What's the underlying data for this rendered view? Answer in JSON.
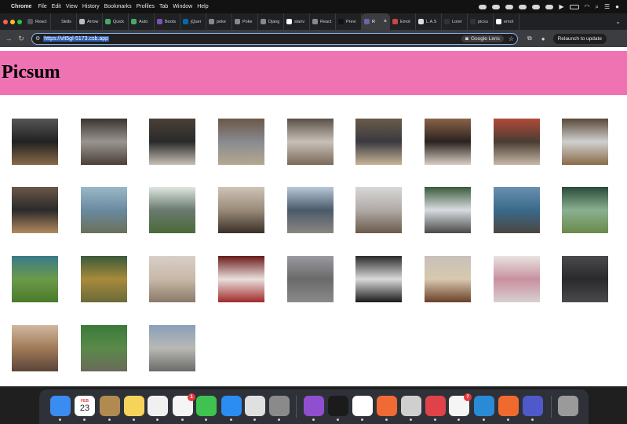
{
  "menubar": {
    "app_name": "Chrome",
    "items": [
      "File",
      "Edit",
      "View",
      "History",
      "Bookmarks",
      "Profiles",
      "Tab",
      "Window",
      "Help"
    ]
  },
  "tabs": [
    {
      "label": "React",
      "color": "#555"
    },
    {
      "label": "Skills",
      "color": "#222"
    },
    {
      "label": "Arrow",
      "color": "#bbb"
    },
    {
      "label": "Quick",
      "color": "#4a6"
    },
    {
      "label": "Auto",
      "color": "#4a6"
    },
    {
      "label": "Boots",
      "color": "#7952b3"
    },
    {
      "label": "jQuer",
      "color": "#0769ad"
    },
    {
      "label": "poke",
      "color": "#888"
    },
    {
      "label": "Poke",
      "color": "#888"
    },
    {
      "label": "Djang",
      "color": "#888"
    },
    {
      "label": "stanv",
      "color": "#fff"
    },
    {
      "label": "React",
      "color": "#888"
    },
    {
      "label": "Previ",
      "color": "#111"
    },
    {
      "label": "R",
      "color": "#66a",
      "active": true
    },
    {
      "label": "Emot",
      "color": "#c44"
    },
    {
      "label": "L.A.S",
      "color": "#ddd"
    },
    {
      "label": "Lorer",
      "color": "#333"
    },
    {
      "label": "picsu",
      "color": "#333"
    },
    {
      "label": "emot",
      "color": "#fff"
    }
  ],
  "toolbar": {
    "url": "https://vlt5gl-5173.csb.app",
    "lens_label": "Google Lens",
    "relaunch_label": "Relaunch to update"
  },
  "page": {
    "title": "Picsum"
  },
  "gallery": [
    {
      "top": "#555",
      "mid": "#222",
      "bot": "#8a6a48"
    },
    {
      "top": "#3a3530",
      "mid": "#9a9490",
      "bot": "#4a4038"
    },
    {
      "top": "#4a4038",
      "mid": "#2a2a2a",
      "bot": "#c8c0b4"
    },
    {
      "top": "#6a5848",
      "mid": "#8a8a90",
      "bot": "#b4a890"
    },
    {
      "top": "#5a5048",
      "mid": "#c8c0b8",
      "bot": "#7a6a58"
    },
    {
      "top": "#6a5a4a",
      "mid": "#3a3a40",
      "bot": "#c8b498"
    },
    {
      "top": "#8a6248",
      "mid": "#2a2220",
      "bot": "#d8cfc2"
    },
    {
      "top": "#b04a38",
      "mid": "#4a3c32",
      "bot": "#c8b8a8"
    },
    {
      "top": "#5a4838",
      "mid": "#d0d0d0",
      "bot": "#8a6a48"
    },
    {
      "top": "#6a5848",
      "mid": "#2a2a2a",
      "bot": "#b48a60"
    },
    {
      "top": "#9ab8c8",
      "mid": "#6a8aa0",
      "bot": "#6a7058"
    },
    {
      "top": "#dfe8e0",
      "mid": "#6a7a70",
      "bot": "#4a6a38"
    },
    {
      "top": "#cfc4b8",
      "mid": "#9a8a78",
      "bot": "#3a3028"
    },
    {
      "top": "#b8c8d8",
      "mid": "#4a5a6a",
      "bot": "#8a8680"
    },
    {
      "top": "#d8d8d8",
      "mid": "#b0aaa6",
      "bot": "#6a5a4a"
    },
    {
      "top": "#3a5a3a",
      "mid": "#d8dce0",
      "bot": "#4a4a48"
    },
    {
      "top": "#6a90b0",
      "mid": "#3a6a8a",
      "bot": "#4a4640"
    },
    {
      "top": "#2a4a3a",
      "mid": "#8ab090",
      "bot": "#6a8a4a"
    },
    {
      "top": "#3a7a8a",
      "mid": "#6a9a4a",
      "bot": "#4a7a2a"
    },
    {
      "top": "#3a5a3a",
      "mid": "#a88a3a",
      "bot": "#6a6a3a"
    },
    {
      "top": "#d8cfc8",
      "mid": "#c8b8a8",
      "bot": "#8a7a6a"
    },
    {
      "top": "#6a1a1a",
      "mid": "#e8e0dc",
      "bot": "#a02a2a"
    },
    {
      "top": "#9a9aa0",
      "mid": "#6a6a6a",
      "bot": "#8a8a8a"
    },
    {
      "top": "#2a2a2a",
      "mid": "#dadada",
      "bot": "#1a1a1a"
    },
    {
      "top": "#c8c0b8",
      "mid": "#d8c8b0",
      "bot": "#6a4028"
    },
    {
      "top": "#e8e4e0",
      "mid": "#c890a0",
      "bot": "#d8d0d0"
    },
    {
      "top": "#4a4a4c",
      "mid": "#2a2a2c",
      "bot": "#4a4a4c"
    },
    {
      "top": "#d0b8a0",
      "mid": "#a07a58",
      "bot": "#5a4438"
    },
    {
      "top": "#3a7a3a",
      "mid": "#5a8a4a",
      "bot": "#6a6a58"
    },
    {
      "top": "#8aa0b8",
      "mid": "#b8b8b4",
      "bot": "#6a6a68"
    }
  ],
  "dock": {
    "calendar_month": "FEB",
    "calendar_day": "23",
    "reminders_badge": "1",
    "photos_badge": "7",
    "apps": [
      {
        "name": "finder",
        "color": "#3a8cf0"
      },
      {
        "name": "calendar",
        "color": "#ffffff"
      },
      {
        "name": "notes-app",
        "color": "#b08a50"
      },
      {
        "name": "notes",
        "color": "#f6d35a"
      },
      {
        "name": "freeform",
        "color": "#f0f0f0"
      },
      {
        "name": "reminders",
        "color": "#f5f5f5"
      },
      {
        "name": "messages",
        "color": "#3fc24f"
      },
      {
        "name": "app-store",
        "color": "#2b8cf2"
      },
      {
        "name": "chrome",
        "color": "#e0e0e0"
      },
      {
        "name": "system-settings",
        "color": "#8a8a8a"
      },
      {
        "name": "github-desktop",
        "color": "#8f4fcf"
      },
      {
        "name": "terminal",
        "color": "#1b1b1b"
      },
      {
        "name": "slack",
        "color": "#ffffff"
      },
      {
        "name": "postman",
        "color": "#ef6a35"
      },
      {
        "name": "disk-app",
        "color": "#cfcfcf"
      },
      {
        "name": "red-app",
        "color": "#e0424a"
      },
      {
        "name": "photos",
        "color": "#f5f5f5"
      },
      {
        "name": "vscode",
        "color": "#2b8ad6"
      },
      {
        "name": "draw-app",
        "color": "#f06a30"
      },
      {
        "name": "teams",
        "color": "#5059c9"
      },
      {
        "name": "trash",
        "color": "#9a9a9a"
      }
    ]
  }
}
